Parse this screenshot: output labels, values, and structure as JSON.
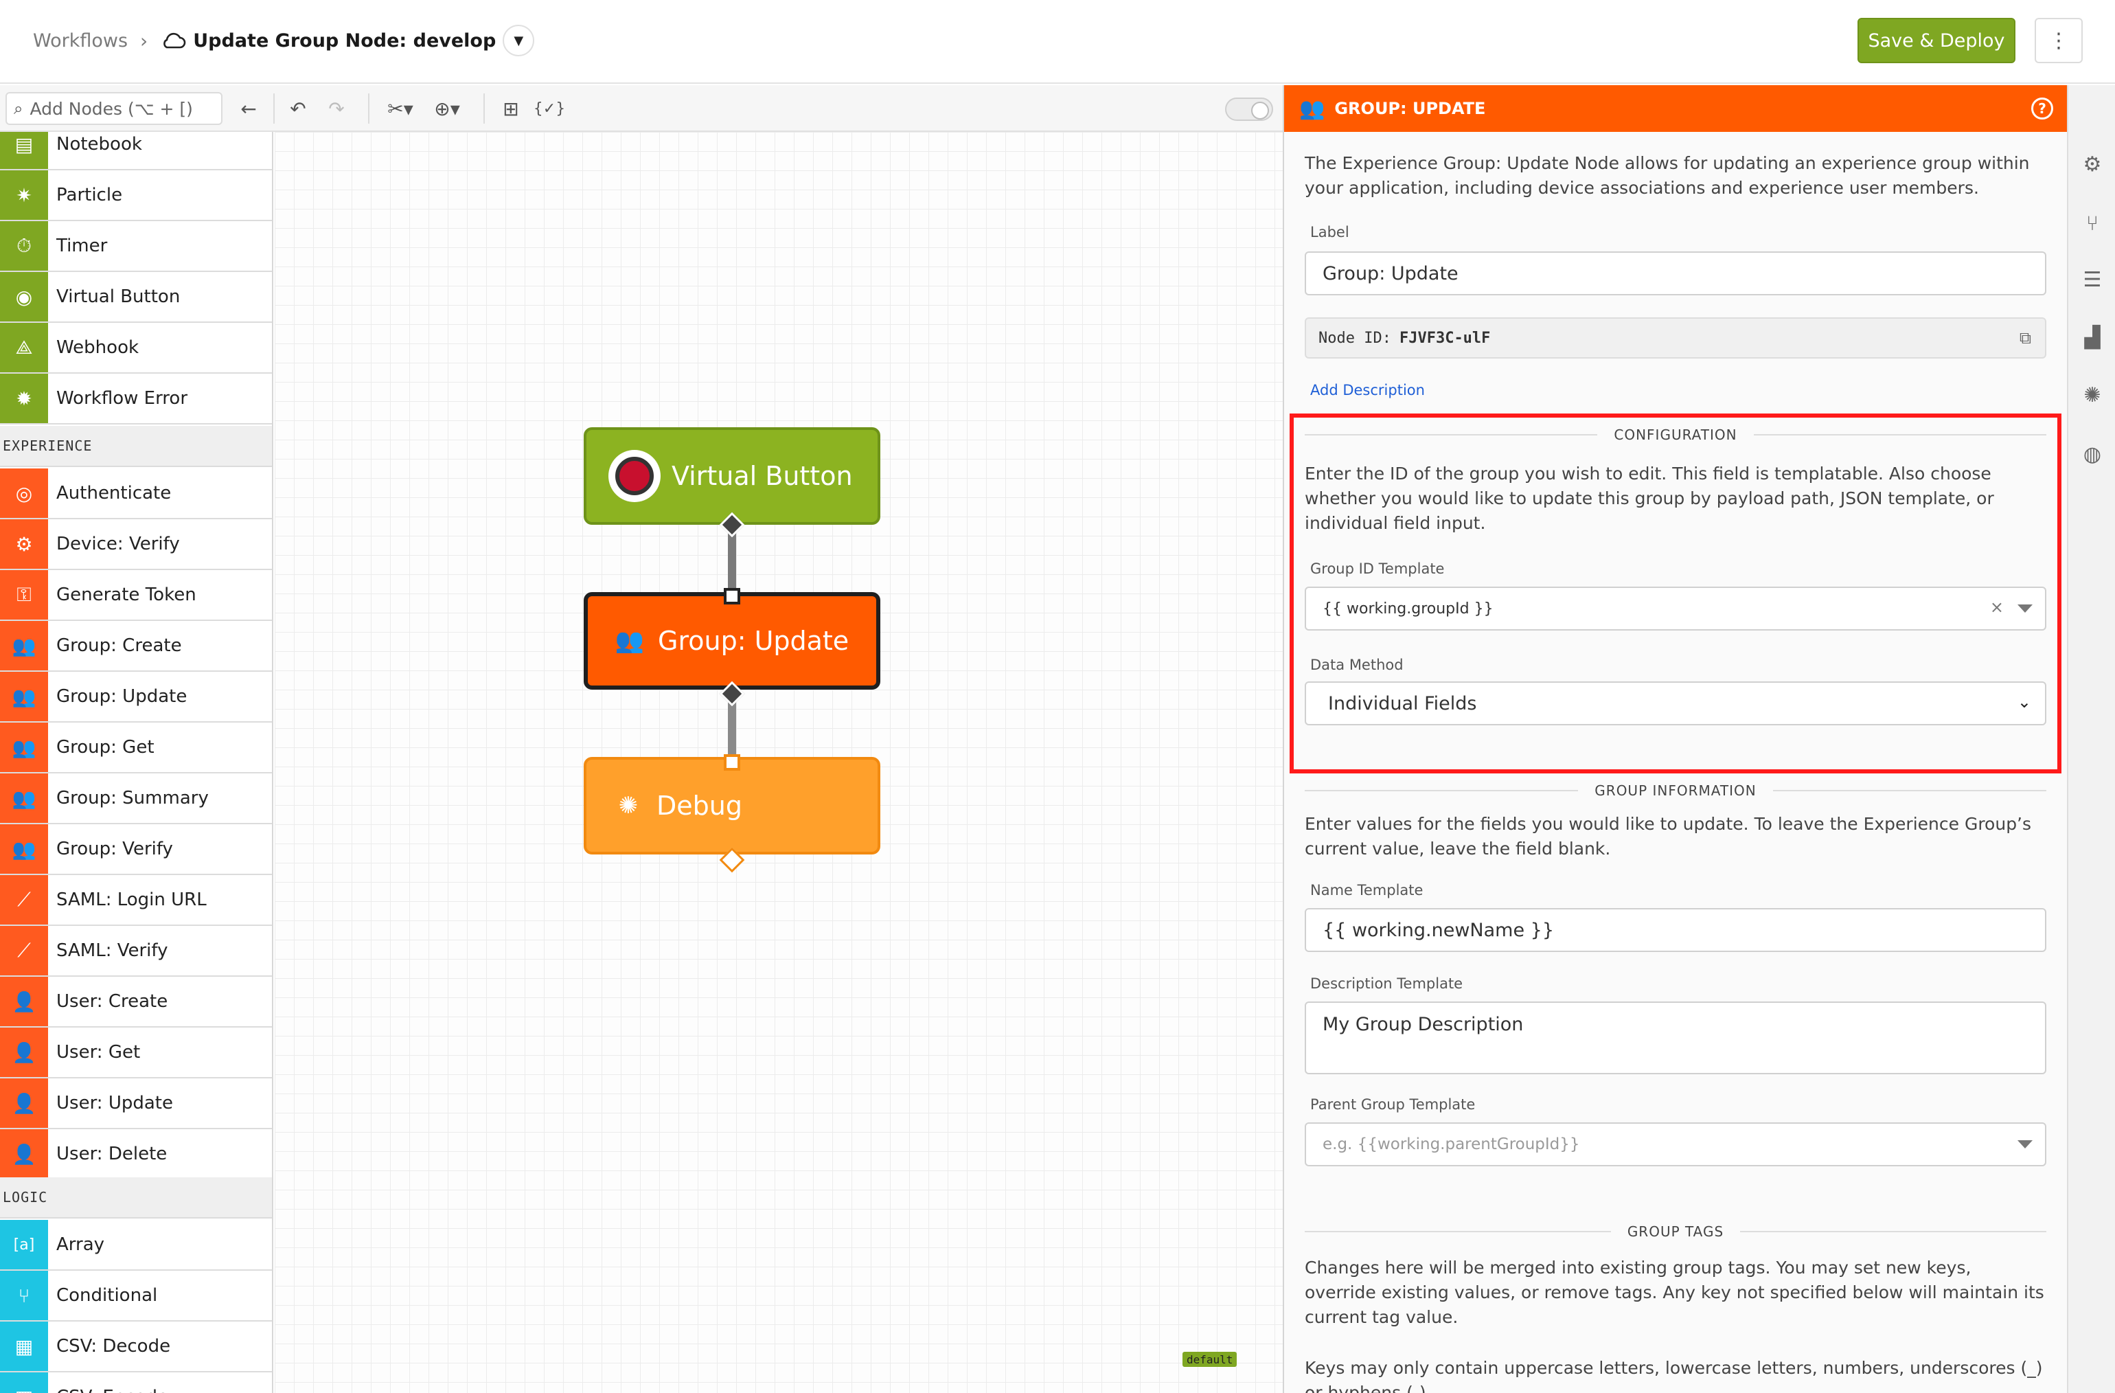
{
  "header": {
    "breadcrumb_root": "Workflows",
    "breadcrumb_separator": "›",
    "workflow_title": "Update Group Node: develop",
    "save_label": "Save & Deploy",
    "more_label": "⋮"
  },
  "toolbar": {
    "search_placeholder": "Add Nodes (⌥ + [)",
    "expression_label": "{✓}"
  },
  "palette": {
    "items_top": [
      {
        "label": "Notebook",
        "icon": "notebook-icon",
        "glyph": "▤"
      },
      {
        "label": "Particle",
        "icon": "particle-icon",
        "glyph": "✷"
      },
      {
        "label": "Timer",
        "icon": "timer-icon",
        "glyph": "⏱"
      },
      {
        "label": "Virtual Button",
        "icon": "virtual-button-icon",
        "glyph": "◉"
      },
      {
        "label": "Webhook",
        "icon": "webhook-icon",
        "glyph": "⟁"
      },
      {
        "label": "Workflow Error",
        "icon": "workflow-error-icon",
        "glyph": "✹"
      }
    ],
    "category_experience": "EXPERIENCE",
    "experience_items": [
      {
        "label": "Authenticate",
        "icon": "fingerprint-icon",
        "glyph": "◎"
      },
      {
        "label": "Device: Verify",
        "icon": "device-verify-icon",
        "glyph": "⚙"
      },
      {
        "label": "Generate Token",
        "icon": "key-icon",
        "glyph": "⚿"
      },
      {
        "label": "Group: Create",
        "icon": "group-create-icon",
        "glyph": "👥"
      },
      {
        "label": "Group: Update",
        "icon": "group-update-icon",
        "glyph": "👥"
      },
      {
        "label": "Group: Get",
        "icon": "group-get-icon",
        "glyph": "👥"
      },
      {
        "label": "Group: Summary",
        "icon": "group-summary-icon",
        "glyph": "👥"
      },
      {
        "label": "Group: Verify",
        "icon": "group-verify-icon",
        "glyph": "👥"
      },
      {
        "label": "SAML: Login URL",
        "icon": "saml-login-icon",
        "glyph": "⟋"
      },
      {
        "label": "SAML: Verify",
        "icon": "saml-verify-icon",
        "glyph": "⟋"
      },
      {
        "label": "User: Create",
        "icon": "user-create-icon",
        "glyph": "👤"
      },
      {
        "label": "User: Get",
        "icon": "user-get-icon",
        "glyph": "👤"
      },
      {
        "label": "User: Update",
        "icon": "user-update-icon",
        "glyph": "👤"
      },
      {
        "label": "User: Delete",
        "icon": "user-delete-icon",
        "glyph": "👤"
      }
    ],
    "category_logic": "LOGIC",
    "logic_items": [
      {
        "label": "Array",
        "icon": "array-icon",
        "glyph": "[a]"
      },
      {
        "label": "Conditional",
        "icon": "conditional-icon",
        "glyph": "⑂"
      },
      {
        "label": "CSV: Decode",
        "icon": "csv-decode-icon",
        "glyph": "▦"
      },
      {
        "label": "CSV: Encode",
        "icon": "csv-encode-icon",
        "glyph": "▦"
      }
    ]
  },
  "canvas": {
    "node_virtual_button": "Virtual Button",
    "node_group_update": "Group: Update",
    "node_debug": "Debug",
    "default_tag": "default"
  },
  "panel": {
    "title": "GROUP: UPDATE",
    "help": "?",
    "intro": "The Experience Group: Update Node allows for updating an experience group within your application, including device associations and experience user members.",
    "label_label": "Label",
    "label_value": "Group: Update",
    "node_id_label": "Node ID:",
    "node_id_value": "FJVF3C-ulF",
    "add_description": "Add Description",
    "configuration_heading": "CONFIGURATION",
    "configuration_text": "Enter the ID of the group you wish to edit. This field is templatable. Also choose whether you would like to update this group by payload path, JSON template, or individual field input.",
    "group_id_label": "Group ID Template",
    "group_id_value": "{{ working.groupId }}",
    "data_method_label": "Data Method",
    "data_method_value": "Individual Fields",
    "group_info_heading": "GROUP INFORMATION",
    "group_info_text": "Enter values for the fields you would like to update. To leave the Experience Group’s current value, leave the field blank.",
    "name_label": "Name Template",
    "name_value": "{{ working.newName }}",
    "description_label": "Description Template",
    "description_value": "My Group Description",
    "parent_label": "Parent Group Template",
    "parent_placeholder": "e.g. {{working.parentGroupId}}",
    "tags_heading": "GROUP TAGS",
    "tags_text": "Changes here will be merged into existing group tags. You may set new keys, override existing values, or remove tags. Any key not specified below will maintain its current tag value.",
    "keys_text": "Keys may only contain uppercase letters, lowercase letters, numbers, underscores (_) or hyphens (-)."
  },
  "colors": {
    "accent_orange": "#ff5a00",
    "accent_green": "#7fa722",
    "experience_orange": "#ff5a1f",
    "logic_cyan": "#1ec5e3",
    "highlight_red": "#ff1a1a"
  }
}
